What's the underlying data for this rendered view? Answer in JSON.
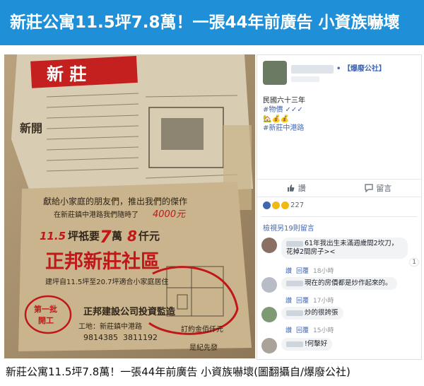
{
  "headline": "新莊公寓11.5坪7.8萬！一張44年前廣告 小資族嚇壞",
  "caption": "新莊公寓11.5坪7.8萬！一張44年前廣告 小資族嚇壞(圖翻攝自/爆廢公社)",
  "newspaper": {
    "top_header": "新 莊",
    "intro_line": "獻給小家庭的朋友們，推出我們的傑作",
    "location_line": "在新莊鎮中港路我們隨時了",
    "price_left": "11.5",
    "price_mid": "坪祇要",
    "price_big": "7",
    "price_unit": "萬",
    "price_8": "8",
    "price_thousand": "仟元",
    "project_name": "正邦新莊社區",
    "building_line": "建坪自11.5坪至20.7坪適合小家庭居住",
    "developer": "正邦建設公司投資監造",
    "address": "工地：新莊鎮中港路",
    "phone": "9814385",
    "phone2": "3811192",
    "deposit": "訂約金佰仟元",
    "stamp": "第一批",
    "stamp2": "開工",
    "sign_top": "新開",
    "corner_text": "是紀先發"
  },
  "post": {
    "page_name": "• 【爆廢公社】",
    "lines": [
      "民國六十三年",
      "#物價 ✓✓✓",
      "🏡💰💰",
      "#新莊中港路"
    ],
    "like_label": "讚",
    "comment_label": "留言",
    "reaction_count": "227",
    "view_previous": "檢視另19則留言"
  },
  "comments": [
    {
      "text": "61年我出生未滿週歲間2坎刀，花掉2間房子><",
      "time": "18小時",
      "likes": "1"
    },
    {
      "text": "現在的房價都是炒作起來的。",
      "time": "17小時",
      "likes": ""
    },
    {
      "text": "炒的很誇張",
      "time": "15小時",
      "likes": ""
    },
    {
      "text": "!何擊好",
      "time": "",
      "likes": ""
    }
  ],
  "comment_actions": {
    "like": "讚",
    "reply": "回覆"
  },
  "colors": {
    "banner": "#1f8fd7",
    "link": "#4267b2",
    "paper": "#c9b48e",
    "ad_red": "#c01818"
  }
}
